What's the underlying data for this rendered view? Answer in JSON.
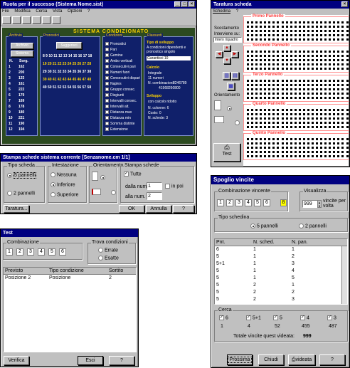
{
  "main_window": {
    "title": "Ruota per il successo (Sistema Nome.sist)",
    "menu": [
      "File",
      "Modifica",
      "Cerca",
      "Vista",
      "Opzioni",
      "?"
    ],
    "panel_title": "SISTEMA CONDIZIONATO",
    "archivio": {
      "label": "Archivio",
      "btn_archivio": "Archivio",
      "btn_sistema": "Sistema",
      "col_headers": [
        "N.",
        "Sorg."
      ],
      "rows": [
        [
          "1",
          "162"
        ],
        [
          "2",
          "200"
        ],
        [
          "3",
          "133"
        ],
        [
          "4",
          "161"
        ],
        [
          "5",
          "222"
        ],
        [
          "6",
          "179"
        ],
        [
          "7",
          "169"
        ],
        [
          "8",
          "178"
        ],
        [
          "9",
          "180"
        ],
        [
          "10",
          "221"
        ],
        [
          "11",
          "190"
        ],
        [
          "12",
          "194"
        ]
      ]
    },
    "pronostici": {
      "label": "Pronostici",
      "btn": "Suggerisci",
      "rows": [
        "8 9 10 11 12 13 14 15 16 17 18",
        "19 20 21 22 23 24 25 26 27 28",
        "29 30 31 32 33 34 35 36 37 38",
        "39 40 41 42 43 44 45 46 47 48",
        "49 50 51 52 53 54 55 56 57 58"
      ]
    },
    "condizioni": {
      "label": "Condizioni",
      "items": [
        "Pronostici",
        "Pari",
        "Gemine",
        "Ambo verticali",
        "Consecutivi pari",
        "Numeri fuori",
        "Consecutivi dispari",
        "Naples",
        "Gruppo consec.",
        "Disgiunti",
        "Intervalli consec.",
        "Intervalli alt.",
        "Distanza max",
        "Distanza min",
        "Somma distinte",
        "Estensione"
      ]
    },
    "riassunto": {
      "label": "Riassunti",
      "tipo_sviluppo": "Tipo di sviluppo",
      "tipo_desc": "A condizioni dipendenti e pronostico singolo",
      "select": "Garantisci 10",
      "calcolo_label": "Calcolo",
      "integrale": "Integrale",
      "colonne": "11 numeri",
      "costo_label": "N. combinazioni",
      "costo": "8246789",
      "costo2": "41968260800",
      "sviluppo_label": "Sviluppo",
      "sviluppo_desc": "con calcolo ridotto",
      "n_colonne": "N. colonne: 6",
      "costo3": "Costo: 0",
      "n_schede": "N. schede: 3"
    }
  },
  "taratura": {
    "title": "Taratura scheda",
    "menu": [
      "Schedina",
      "?"
    ],
    "scostamento": "Scostamento",
    "interviene_su": "Interviene su:",
    "select_value": "Intero riquadro",
    "orientamento": "Orientamento",
    "test_btn": "Test",
    "panels": [
      "Primo Pannello",
      "Secondo Pannello",
      "Terzo Pannello",
      "Quarto Pannello",
      "Quinto Pannello"
    ]
  },
  "stampa": {
    "title": "Stampa schede sistema corrente [Senzanome.cm 1/1]",
    "tipo_scheda": "Tipo scheda",
    "opt_5": "5 pannelli",
    "opt_2": "2 pannelli",
    "intestazione": "Intestazione",
    "int_opts": [
      "Nessuna",
      "Inferiore",
      "Superiore"
    ],
    "orientamento": "Orientamento",
    "stampa_schede": "Stampa schede",
    "tutte": "Tutte",
    "dalla_num": "dalla num.",
    "dalla_val": "1",
    "in_poi": "in poi",
    "alla_num": "alla num.",
    "alla_val": "2",
    "btn_taratura": "Taratura...",
    "btn_ok": "OK",
    "btn_annulla": "Annulla",
    "btn_help": "?"
  },
  "test": {
    "title": "Test",
    "combinazione": "Combinazione",
    "combo": [
      "1",
      "2",
      "3",
      "4",
      "5",
      "6"
    ],
    "trova": "Trova condizioni",
    "errate": "Errate",
    "esatte": "Esatte",
    "headers": [
      "Previsto",
      "Tipo condizione",
      "Sortito"
    ],
    "rows": [
      [
        "Posizione 2",
        "Posizione",
        "2"
      ]
    ],
    "btn_verifica": "Verifica",
    "btn_esci": "Esci",
    "btn_help": "?"
  },
  "spoglio": {
    "title": "Spoglio vincite",
    "combinazione": "Combinazione vincente",
    "combo": [
      "1",
      "2",
      "3",
      "4",
      "5",
      "6"
    ],
    "jolly": "8",
    "visualizza": "Visualizza",
    "vis_val": "999",
    "vis_label": "vincite per volta",
    "tipo_schedina": "Tipo schedina",
    "opt_5": "5 pannelli",
    "opt_2": "2 pannelli",
    "headers": [
      "Pnt.",
      "N. sched.",
      "N. pan."
    ],
    "rows": [
      [
        "6",
        "1",
        "1"
      ],
      [
        "5",
        "1",
        "2"
      ],
      [
        "5+1",
        "1",
        "3"
      ],
      [
        "5",
        "1",
        "4"
      ],
      [
        "5",
        "1",
        "5"
      ],
      [
        "5",
        "2",
        "1"
      ],
      [
        "5",
        "2",
        "2"
      ],
      [
        "5",
        "2",
        "3"
      ]
    ],
    "cerca": "Cerca",
    "cerca_items": [
      {
        "label": "6",
        "count": "1"
      },
      {
        "label": "5+1",
        "count": "4"
      },
      {
        "label": "5",
        "count": "52"
      },
      {
        "label": "4",
        "count": "455"
      },
      {
        "label": "3",
        "count": "487"
      }
    ],
    "totale_label": "Totale vincite quest videata:",
    "totale": "999",
    "btn_prossima": "Prossima",
    "btn_chiudi": "Chiudi",
    "btn_videata": "videata",
    "btn_help": "?"
  }
}
